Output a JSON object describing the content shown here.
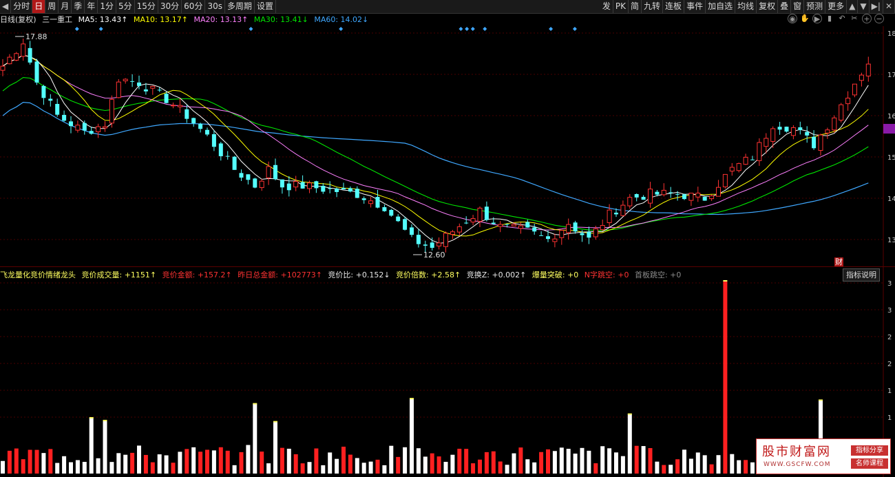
{
  "toolbar": {
    "left_items": [
      "分时",
      "日",
      "周",
      "月",
      "季",
      "年",
      "1分",
      "5分",
      "15分",
      "30分",
      "60分",
      "30s",
      "多周期",
      "设置"
    ],
    "active": "日",
    "right_items": [
      "发",
      "PK",
      "简",
      "九转",
      "连板",
      "事件",
      "加自选",
      "均线",
      "复权",
      "叠",
      "窗",
      "预测",
      "更多"
    ]
  },
  "ma_line": {
    "period": "日线(复权)",
    "stock": "三一重工",
    "ma5": "MA5: 13.43↑",
    "ma10": "MA10: 13.17↑",
    "ma20": "MA20: 13.13↑",
    "ma30": "MA30: 13.41↓",
    "ma60": "MA60: 14.02↓"
  },
  "price_labels": {
    "high": "17.88",
    "low": "12.60"
  },
  "axis_right": [
    "18",
    "17",
    "16",
    "15",
    "14",
    "13"
  ],
  "badge_cai": "财",
  "indicator": {
    "name": "飞龙量化竞价情绪龙头",
    "vol": "竞价成交量: +1151↑",
    "amount": "竞价金额: +157.2↑",
    "prev_total": "昨日总金额: +102773↑",
    "ratio": "竞价比: +0.152↓",
    "mult": "竞价倍数: +2.58↑",
    "turnover": "竞换Z: +0.002↑",
    "burst": "爆量突破: +0",
    "ngap": "N字跳空: +0",
    "firstgap": "首板跳空: +0",
    "help_button": "指标说明"
  },
  "indicator_axis": [
    "3",
    "3",
    "2",
    "2",
    "1",
    "1"
  ],
  "watermark": {
    "title": "股市财富网",
    "url": "WWW.GSCFW.COM",
    "tag1": "指标分享",
    "tag2": "名师课程"
  },
  "colors": {
    "up": "#ff3232",
    "down": "#54ffff",
    "ma5": "#ffffff",
    "ma10": "#ffff00",
    "ma20": "#ff80ff",
    "ma30": "#00e600",
    "ma60": "#3fa8ff"
  }
}
